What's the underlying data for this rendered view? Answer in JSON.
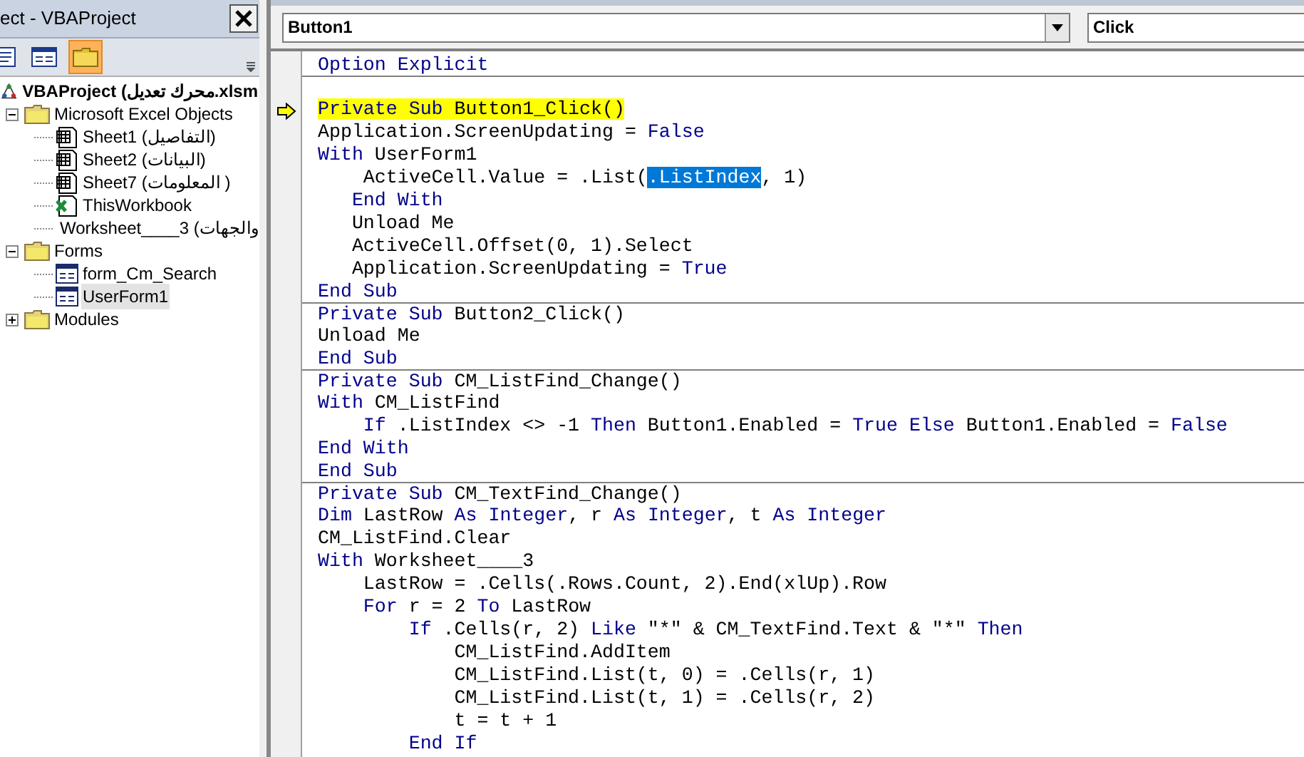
{
  "project_window": {
    "title": "ect - VBAProject",
    "toolbar": [
      {
        "kind": "view-code",
        "selected": false
      },
      {
        "kind": "view-object",
        "selected": false
      },
      {
        "kind": "toggle-folders",
        "selected": true
      }
    ],
    "tree": [
      {
        "label": "VBAProject (محرك تعديل.xlsm",
        "kind": "project",
        "selected": false,
        "children": [
          {
            "label": "Microsoft Excel Objects",
            "kind": "folder",
            "expanded": true,
            "selected": false,
            "children": [
              {
                "label": "Sheet1 (التفاصيل)",
                "kind": "sheet",
                "selected": false
              },
              {
                "label": "Sheet2 (البيانات)",
                "kind": "sheet",
                "selected": false
              },
              {
                "label": "Sheet7 (المعلومات )",
                "kind": "sheet",
                "selected": false
              },
              {
                "label": "ThisWorkbook",
                "kind": "workbook",
                "selected": false
              },
              {
                "label": "Worksheet____3 (والجهات",
                "kind": "sheet",
                "selected": false
              }
            ]
          },
          {
            "label": "Forms",
            "kind": "folder",
            "expanded": true,
            "selected": false,
            "children": [
              {
                "label": "form_Cm_Search",
                "kind": "form",
                "selected": false
              },
              {
                "label": "UserForm1",
                "kind": "form",
                "selected": true
              }
            ]
          },
          {
            "label": "Modules",
            "kind": "folder",
            "expanded": false,
            "selected": false
          }
        ]
      }
    ]
  },
  "code_window": {
    "object": "Button1",
    "procedure": "Click",
    "lines": [
      {
        "kind": "code",
        "tokens": [
          {
            "text": "Option Explicit",
            "kind": "keyword"
          }
        ]
      },
      {
        "kind": "blank",
        "separator_before": true
      },
      {
        "kind": "code",
        "current": true,
        "tokens": [
          {
            "text": "Private Sub",
            "kind": "keyword"
          },
          {
            "text": " Button1_Click()",
            "kind": "plain"
          }
        ]
      },
      {
        "kind": "code",
        "tokens": [
          {
            "text": "Application.ScreenUpdating = ",
            "kind": "plain"
          },
          {
            "text": "False",
            "kind": "keyword"
          }
        ]
      },
      {
        "kind": "code",
        "tokens": [
          {
            "text": "With",
            "kind": "keyword"
          },
          {
            "text": " UserForm1",
            "kind": "plain"
          }
        ]
      },
      {
        "kind": "code",
        "tokens": [
          {
            "text": "    ActiveCell.Value = .List(",
            "kind": "plain"
          },
          {
            "text": ".ListIndex",
            "kind": "selected"
          },
          {
            "text": ", 1)",
            "kind": "plain"
          }
        ]
      },
      {
        "kind": "code",
        "tokens": [
          {
            "text": "   End With",
            "kind": "keyword"
          }
        ]
      },
      {
        "kind": "code",
        "tokens": [
          {
            "text": "   Unload Me",
            "kind": "plain"
          }
        ]
      },
      {
        "kind": "code",
        "tokens": [
          {
            "text": "   ActiveCell.Offset(0, 1).Select",
            "kind": "plain"
          }
        ]
      },
      {
        "kind": "code",
        "tokens": [
          {
            "text": "   Application.ScreenUpdating = ",
            "kind": "plain"
          },
          {
            "text": "True",
            "kind": "keyword"
          }
        ]
      },
      {
        "kind": "code",
        "tokens": [
          {
            "text": "End Sub",
            "kind": "keyword"
          }
        ]
      },
      {
        "kind": "code",
        "separator_before": true,
        "tokens": [
          {
            "text": "Private Sub",
            "kind": "keyword"
          },
          {
            "text": " Button2_Click()",
            "kind": "plain"
          }
        ]
      },
      {
        "kind": "code",
        "tokens": [
          {
            "text": "Unload Me",
            "kind": "plain"
          }
        ]
      },
      {
        "kind": "code",
        "tokens": [
          {
            "text": "End Sub",
            "kind": "keyword"
          }
        ]
      },
      {
        "kind": "code",
        "separator_before": true,
        "tokens": [
          {
            "text": "Private Sub",
            "kind": "keyword"
          },
          {
            "text": " CM_ListFind_Change()",
            "kind": "plain"
          }
        ]
      },
      {
        "kind": "code",
        "tokens": [
          {
            "text": "With",
            "kind": "keyword"
          },
          {
            "text": " CM_ListFind",
            "kind": "plain"
          }
        ]
      },
      {
        "kind": "code",
        "tokens": [
          {
            "text": "    If",
            "kind": "keyword"
          },
          {
            "text": " .ListIndex <> -1 ",
            "kind": "plain"
          },
          {
            "text": "Then",
            "kind": "keyword"
          },
          {
            "text": " Button1.Enabled = ",
            "kind": "plain"
          },
          {
            "text": "True Else",
            "kind": "keyword"
          },
          {
            "text": " Button1.Enabled = ",
            "kind": "plain"
          },
          {
            "text": "False",
            "kind": "keyword"
          }
        ]
      },
      {
        "kind": "code",
        "tokens": [
          {
            "text": "End With",
            "kind": "keyword"
          }
        ]
      },
      {
        "kind": "code",
        "tokens": [
          {
            "text": "End Sub",
            "kind": "keyword"
          }
        ]
      },
      {
        "kind": "code",
        "separator_before": true,
        "tokens": [
          {
            "text": "Private Sub",
            "kind": "keyword"
          },
          {
            "text": " CM_TextFind_Change()",
            "kind": "plain"
          }
        ]
      },
      {
        "kind": "code",
        "tokens": [
          {
            "text": "Dim",
            "kind": "keyword"
          },
          {
            "text": " LastRow ",
            "kind": "plain"
          },
          {
            "text": "As Integer",
            "kind": "keyword"
          },
          {
            "text": ", r ",
            "kind": "plain"
          },
          {
            "text": "As Integer",
            "kind": "keyword"
          },
          {
            "text": ", t ",
            "kind": "plain"
          },
          {
            "text": "As Integer",
            "kind": "keyword"
          }
        ]
      },
      {
        "kind": "code",
        "tokens": [
          {
            "text": "CM_ListFind.Clear",
            "kind": "plain"
          }
        ]
      },
      {
        "kind": "code",
        "tokens": [
          {
            "text": "With",
            "kind": "keyword"
          },
          {
            "text": " Worksheet____3",
            "kind": "plain"
          }
        ]
      },
      {
        "kind": "code",
        "tokens": [
          {
            "text": "    LastRow = .Cells(.Rows.Count, 2).End(xlUp).Row",
            "kind": "plain"
          }
        ]
      },
      {
        "kind": "code",
        "tokens": [
          {
            "text": "    For",
            "kind": "keyword"
          },
          {
            "text": " r = 2 ",
            "kind": "plain"
          },
          {
            "text": "To",
            "kind": "keyword"
          },
          {
            "text": " LastRow",
            "kind": "plain"
          }
        ]
      },
      {
        "kind": "code",
        "tokens": [
          {
            "text": "        If",
            "kind": "keyword"
          },
          {
            "text": " .Cells(r, 2) ",
            "kind": "plain"
          },
          {
            "text": "Like",
            "kind": "keyword"
          },
          {
            "text": " \"*\" & CM_TextFind.Text & \"*\" ",
            "kind": "plain"
          },
          {
            "text": "Then",
            "kind": "keyword"
          }
        ]
      },
      {
        "kind": "code",
        "tokens": [
          {
            "text": "            CM_ListFind.AddItem",
            "kind": "plain"
          }
        ]
      },
      {
        "kind": "code",
        "tokens": [
          {
            "text": "            CM_ListFind.List(t, 0) = .Cells(r, 1)",
            "kind": "plain"
          }
        ]
      },
      {
        "kind": "code",
        "tokens": [
          {
            "text": "            CM_ListFind.List(t, 1) = .Cells(r, 2)",
            "kind": "plain"
          }
        ]
      },
      {
        "kind": "code",
        "tokens": [
          {
            "text": "            t = t + 1",
            "kind": "plain"
          }
        ]
      },
      {
        "kind": "code",
        "tokens": [
          {
            "text": "        End If",
            "kind": "keyword"
          }
        ]
      }
    ]
  }
}
